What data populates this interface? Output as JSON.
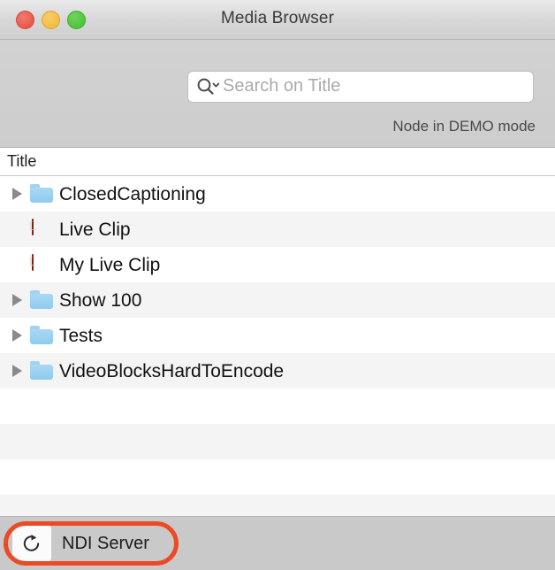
{
  "window": {
    "title": "Media Browser",
    "traffic_lights": [
      {
        "name": "close",
        "color": "#e9594c"
      },
      {
        "name": "minimize",
        "color": "#f1bd45"
      },
      {
        "name": "zoom",
        "color": "#4fc63c"
      }
    ]
  },
  "toolbar": {
    "search": {
      "placeholder": "Search on Title",
      "value": "",
      "icon": "search-icon",
      "menu_icon": "chevron-down-icon"
    },
    "status_note": "Node in DEMO mode"
  },
  "list": {
    "columns": [
      "Title"
    ],
    "rows": [
      {
        "label": "ClosedCaptioning",
        "icon": "folder-icon",
        "expandable": true,
        "expanded": false
      },
      {
        "label": "Live Clip",
        "icon": "live-clip-icon",
        "expandable": false,
        "expanded": false
      },
      {
        "label": "My Live Clip",
        "icon": "live-clip-icon",
        "expandable": false,
        "expanded": false
      },
      {
        "label": "Show 100",
        "icon": "folder-icon",
        "expandable": true,
        "expanded": false
      },
      {
        "label": "Tests",
        "icon": "folder-icon",
        "expandable": true,
        "expanded": false
      },
      {
        "label": "VideoBlocksHardToEncode",
        "icon": "folder-icon",
        "expandable": true,
        "expanded": false
      }
    ],
    "empty_row_count": 4
  },
  "bottom_bar": {
    "refresh_icon": "refresh-icon",
    "server_label": "NDI Server",
    "highlight_color": "#ec4a25"
  }
}
